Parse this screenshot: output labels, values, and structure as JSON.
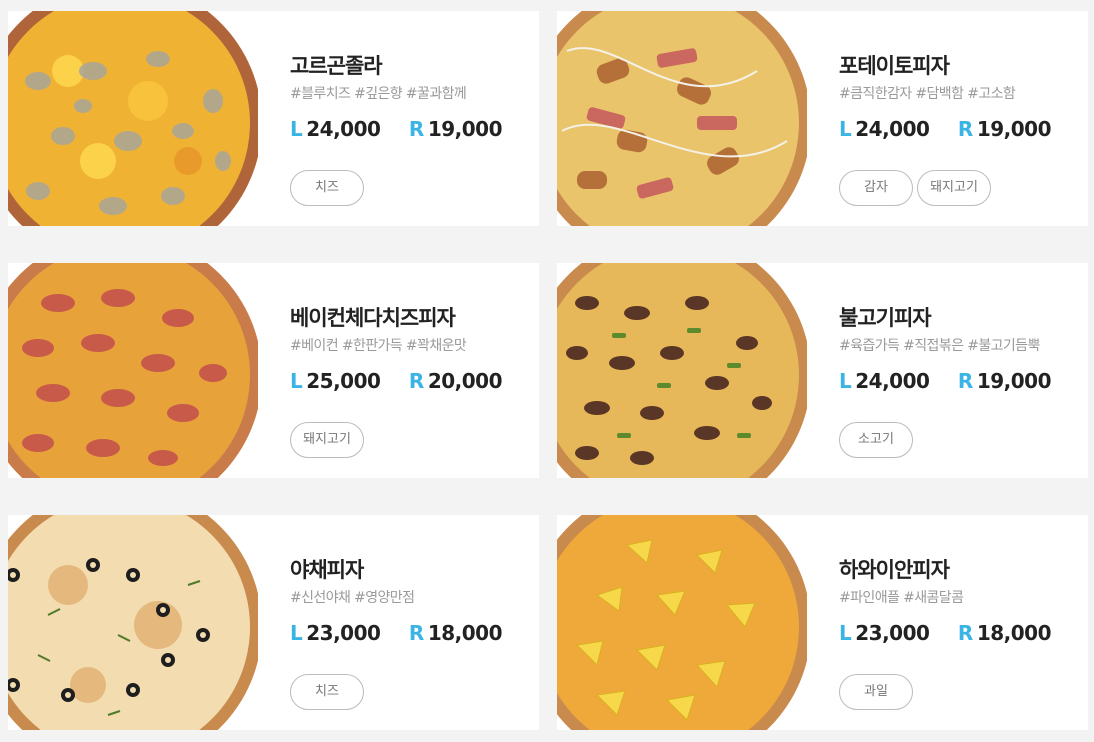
{
  "menu": {
    "items": [
      {
        "name": "고르곤졸라",
        "tags": "#블루치즈 #깊은향 #꿀과함께",
        "price_large_label": "L",
        "price_large": "24,000",
        "price_regular_label": "R",
        "price_regular": "19,000",
        "chips": [
          "치즈"
        ],
        "image": "gorgonzola-pizza"
      },
      {
        "name": "포테이토피자",
        "tags": "#큼직한감자 #담백함 #고소함",
        "price_large_label": "L",
        "price_large": "24,000",
        "price_regular_label": "R",
        "price_regular": "19,000",
        "chips": [
          "감자",
          "돼지고기"
        ],
        "image": "potato-pizza"
      },
      {
        "name": "베이컨체다치즈피자",
        "tags": "#베이컨 #한판가득 #꽉채운맛",
        "price_large_label": "L",
        "price_large": "25,000",
        "price_regular_label": "R",
        "price_regular": "20,000",
        "chips": [
          "돼지고기"
        ],
        "image": "bacon-cheddar-pizza"
      },
      {
        "name": "불고기피자",
        "tags": "#육즙가득 #직접볶은 #불고기듬뿍",
        "price_large_label": "L",
        "price_large": "24,000",
        "price_regular_label": "R",
        "price_regular": "19,000",
        "chips": [
          "소고기"
        ],
        "image": "bulgogi-pizza"
      },
      {
        "name": "야채피자",
        "tags": "#신선야채 #영양만점",
        "price_large_label": "L",
        "price_large": "23,000",
        "price_regular_label": "R",
        "price_regular": "18,000",
        "chips": [
          "치즈"
        ],
        "image": "vegetable-pizza"
      },
      {
        "name": "하와이안피자",
        "tags": "#파인애플 #새콤달콤",
        "price_large_label": "L",
        "price_large": "23,000",
        "price_regular_label": "R",
        "price_regular": "18,000",
        "chips": [
          "과일"
        ],
        "image": "hawaiian-pizza"
      }
    ]
  },
  "colors": {
    "page_background": "#f3f3f3",
    "card_background": "#ffffff",
    "size_accent": "#3ab4e5",
    "price_text": "#222222",
    "tag_text": "#9a9a9a",
    "chip_border": "#bbbbbb"
  }
}
